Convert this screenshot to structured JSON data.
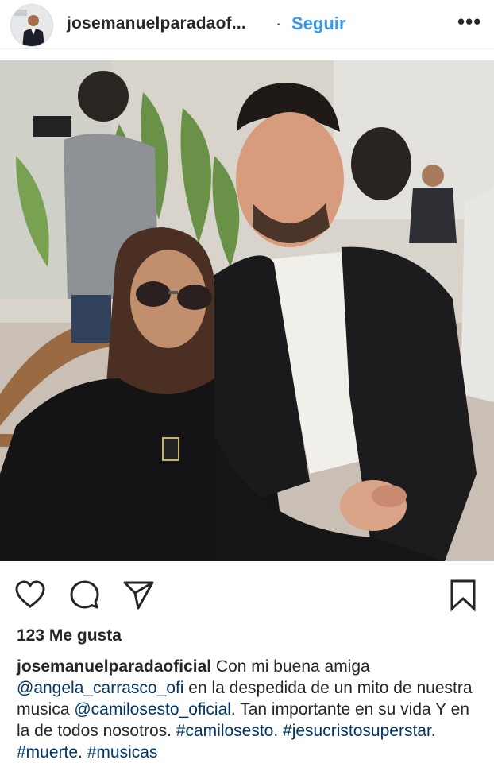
{
  "header": {
    "username": "josemanuelparadaof...",
    "separator": "·",
    "follow_label": "Seguir",
    "more_label": "•••"
  },
  "icons": {
    "like": "heart-icon",
    "comment": "comment-bubble-icon",
    "share": "paper-plane-icon",
    "save": "bookmark-icon"
  },
  "likes": {
    "text": "123 Me gusta"
  },
  "caption": {
    "author": "josemanuelparadaoficial",
    "part1": " Con mi buena amiga ",
    "mention1": "@angela_carrasco_ofi",
    "part2": "  en la despedida de un mito de nuestra musica ",
    "mention2": "@camilosesto_oficial",
    "part3": ". Tan importante en su vida  Y  en la de todos nosotros. ",
    "hashtag1": "#camilosesto",
    "part4": ". ",
    "hashtag2": "#jesucristosuperstar",
    "part5": ". ",
    "hashtag3": "#muerte",
    "part6": ". ",
    "hashtag4": "#musicas"
  },
  "colors": {
    "link": "#003569",
    "follow": "#3897f0",
    "text": "#262626"
  }
}
